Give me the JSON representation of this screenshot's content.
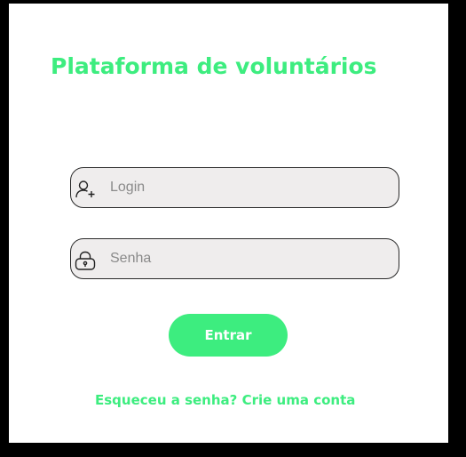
{
  "app": {
    "title": "Plataforma de voluntários"
  },
  "form": {
    "login": {
      "placeholder": "Login",
      "value": "",
      "icon": "user-add-icon"
    },
    "password": {
      "placeholder": "Senha",
      "value": "",
      "icon": "lock-icon"
    },
    "submit_label": "Entrar"
  },
  "links": {
    "forgot_password": "Esqueceu a senha?",
    "separator": " ",
    "create_account": "Crie uma conta"
  },
  "colors": {
    "accent": "#3ded7f",
    "field_background": "#efeded",
    "frame": "#000000"
  }
}
